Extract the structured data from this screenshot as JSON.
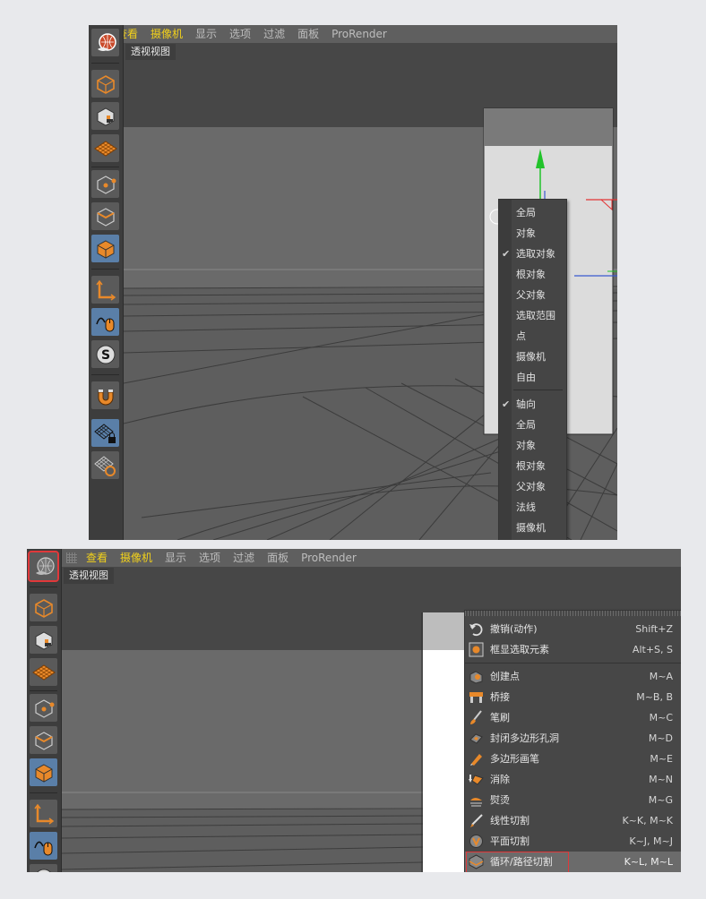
{
  "top_panel": {
    "menu": [
      "查看",
      "摄像机",
      "显示",
      "选项",
      "过滤",
      "面板",
      "ProRender"
    ],
    "view_title": "透视视图",
    "context_menu": {
      "group1": [
        {
          "label": "全局",
          "checked": false
        },
        {
          "label": "对象",
          "checked": false
        },
        {
          "label": "选取对象",
          "checked": true
        },
        {
          "label": "根对象",
          "checked": false
        },
        {
          "label": "父对象",
          "checked": false
        },
        {
          "label": "选取范围",
          "checked": false
        },
        {
          "label": "点",
          "checked": false
        },
        {
          "label": "摄像机",
          "checked": false
        },
        {
          "label": "自由",
          "checked": false
        }
      ],
      "group2": [
        {
          "label": "轴向",
          "checked": true
        },
        {
          "label": "全局",
          "checked": false
        },
        {
          "label": "对象",
          "checked": false
        },
        {
          "label": "根对象",
          "checked": false
        },
        {
          "label": "父对象",
          "checked": false
        },
        {
          "label": "法线",
          "checked": false
        },
        {
          "label": "摄像机",
          "checked": false
        }
      ],
      "check_mark": "✔"
    }
  },
  "bottom_panel": {
    "menu": [
      "查看",
      "摄像机",
      "显示",
      "选项",
      "过滤",
      "面板",
      "ProRender"
    ],
    "view_title": "透视视图",
    "command_menu": [
      {
        "label": "撤销(动作)",
        "shortcut": "Shift+Z",
        "icon": "undo-icon"
      },
      {
        "label": "框显选取元素",
        "shortcut": "Alt+S, S",
        "icon": "frame-selection-icon"
      },
      {
        "label": "创建点",
        "shortcut": "M~A",
        "icon": "create-point-icon"
      },
      {
        "label": "桥接",
        "shortcut": "M~B, B",
        "icon": "bridge-icon"
      },
      {
        "label": "笔刷",
        "shortcut": "M~C",
        "icon": "brush-icon"
      },
      {
        "label": "封闭多边形孔洞",
        "shortcut": "M~D",
        "icon": "close-hole-icon"
      },
      {
        "label": "多边形画笔",
        "shortcut": "M~E",
        "icon": "polygon-pen-icon"
      },
      {
        "label": "消除",
        "shortcut": "M~N",
        "icon": "dissolve-icon"
      },
      {
        "label": "熨烫",
        "shortcut": "M~G",
        "icon": "iron-icon"
      },
      {
        "label": "线性切割",
        "shortcut": "K~K, M~K",
        "icon": "line-cut-icon"
      },
      {
        "label": "平面切割",
        "shortcut": "K~J, M~J",
        "icon": "plane-cut-icon"
      },
      {
        "label": "循环/路径切割",
        "shortcut": "K~L, M~L",
        "icon": "loop-path-cut-icon"
      }
    ]
  },
  "colors": {
    "menu_highlight": "#f2d11b",
    "tool_active": "#5a7fa8",
    "icon_orange": "#e8892a",
    "red_outline": "#e0383a",
    "axis_green": "#22c32b",
    "axis_red": "#e33434",
    "axis_blue": "#3a5ad0"
  }
}
